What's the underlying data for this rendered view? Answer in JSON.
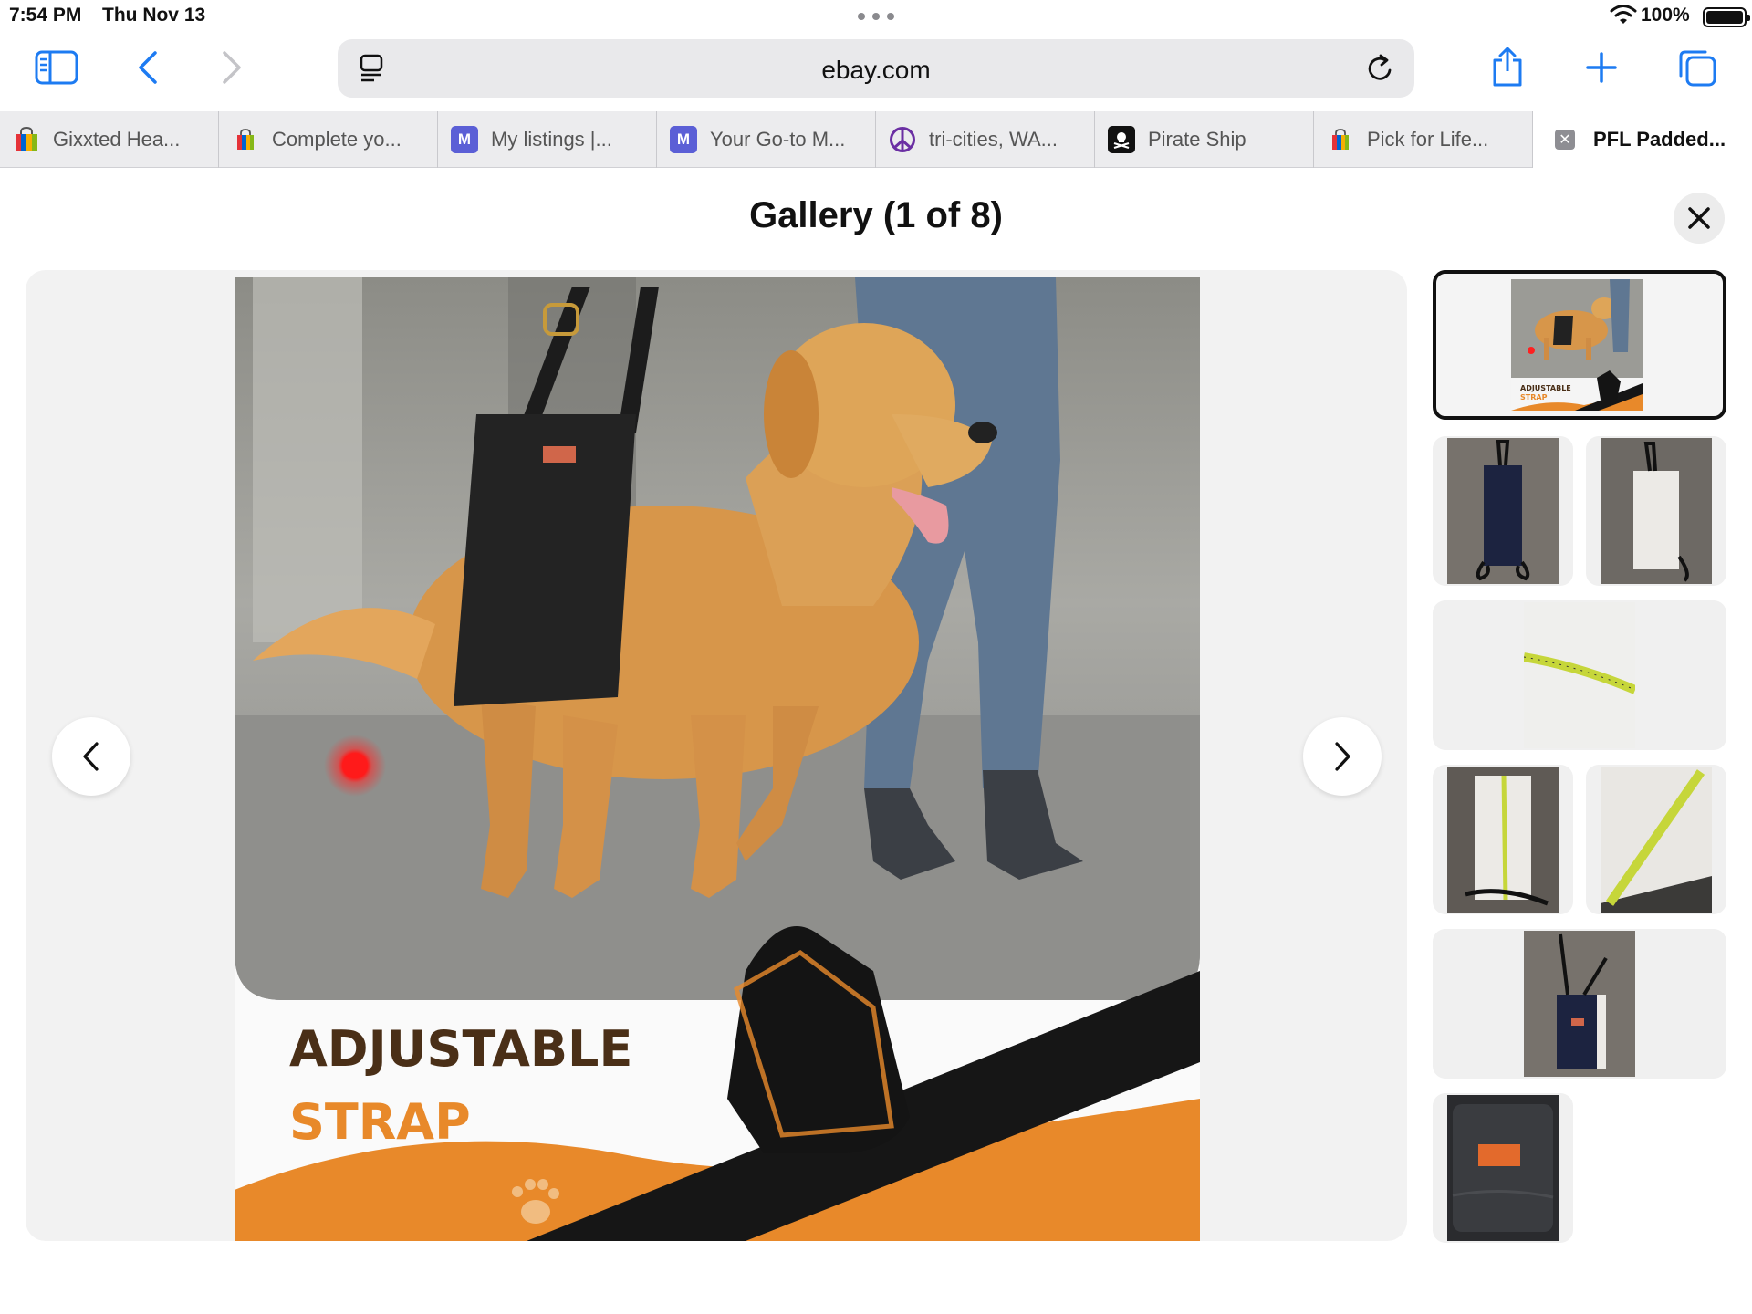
{
  "status": {
    "time": "7:54 PM",
    "date": "Thu Nov 13",
    "battery_percent": "100%",
    "battery_level": 1.0
  },
  "toolbar": {
    "url": "ebay.com",
    "icons": [
      "sidebar-icon",
      "back-icon",
      "forward-icon",
      "reader-icon",
      "reload-icon",
      "share-icon",
      "new-tab-icon",
      "tabs-overview-icon"
    ]
  },
  "tabs": [
    {
      "title": "Gixxted Hea...",
      "icon": "shopping-bag-icon"
    },
    {
      "title": "Complete yo...",
      "icon": "shopping-bag-icon"
    },
    {
      "title": "My listings |...",
      "icon": "M",
      "color": "#5b5fd6"
    },
    {
      "title": "Your Go-to M...",
      "icon": "M",
      "color": "#5b5fd6"
    },
    {
      "title": "tri-cities, WA...",
      "icon": "peace-icon",
      "color": "#6b2fa3"
    },
    {
      "title": "Pirate Ship",
      "icon": "pirate-flag-icon",
      "color": "#111111"
    },
    {
      "title": "Pick for Life...",
      "icon": "shopping-bag-icon"
    },
    {
      "title": "PFL Padded...",
      "icon": "close-tab-icon",
      "active": true
    }
  ],
  "gallery": {
    "title": "Gallery (1 of 8)",
    "current_index": 1,
    "total": 8,
    "main_image": {
      "headline_line1": "ADJUSTABLE",
      "headline_line2": "STRAP"
    },
    "thumbnails": [
      {
        "id": 1,
        "selected": true,
        "caption": "ADJUSTABLE STRAP"
      },
      {
        "id": 2,
        "selected": false
      },
      {
        "id": 3,
        "selected": false
      },
      {
        "id": 4,
        "selected": false
      },
      {
        "id": 5,
        "selected": false
      },
      {
        "id": 6,
        "selected": false
      },
      {
        "id": 7,
        "selected": false
      },
      {
        "id": 8,
        "selected": false
      }
    ]
  },
  "colors": {
    "accent_blue": "#1d7bf2",
    "headline_brown": "#4a2f17",
    "headline_orange": "#e8892a",
    "thumbnail_tag_orange": "#e36a2c"
  }
}
